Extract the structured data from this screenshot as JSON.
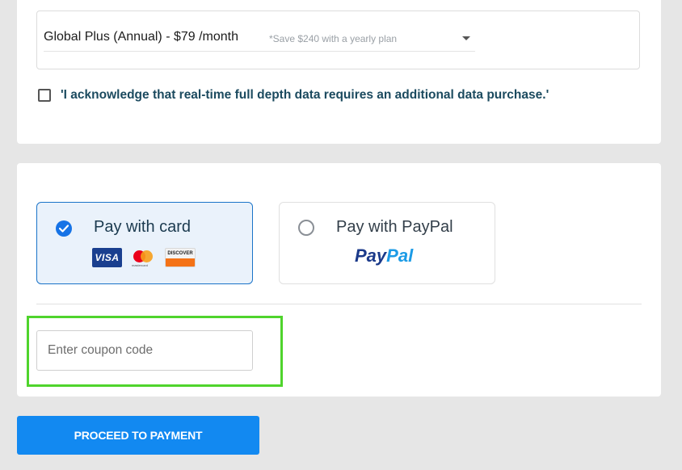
{
  "plan": {
    "selected": "Global Plus (Annual) - $79 /month",
    "save_note": "*Save $240 with a yearly plan",
    "dropdown_icon": "chevron-down-icon"
  },
  "acknowledgement": {
    "checked": false,
    "text": "'I acknowledge that real-time full depth data requires an additional data purchase.'"
  },
  "payment": {
    "card": {
      "label": "Pay with card",
      "selected": true,
      "logos": {
        "visa": "VISA",
        "mastercard": "mastercard",
        "discover": "DISCOVER"
      }
    },
    "paypal": {
      "label": "Pay with PayPal",
      "selected": false,
      "logo_pay": "Pay",
      "logo_pal": "Pal"
    }
  },
  "coupon": {
    "placeholder": "Enter coupon code",
    "value": ""
  },
  "actions": {
    "proceed_label": "PROCEED TO PAYMENT"
  },
  "colors": {
    "accent": "#1289f1",
    "selected_border": "#1a73c8",
    "selected_bg": "#eaf2fb",
    "highlight": "#4fd42c",
    "ack_text": "#1b4a5f"
  }
}
